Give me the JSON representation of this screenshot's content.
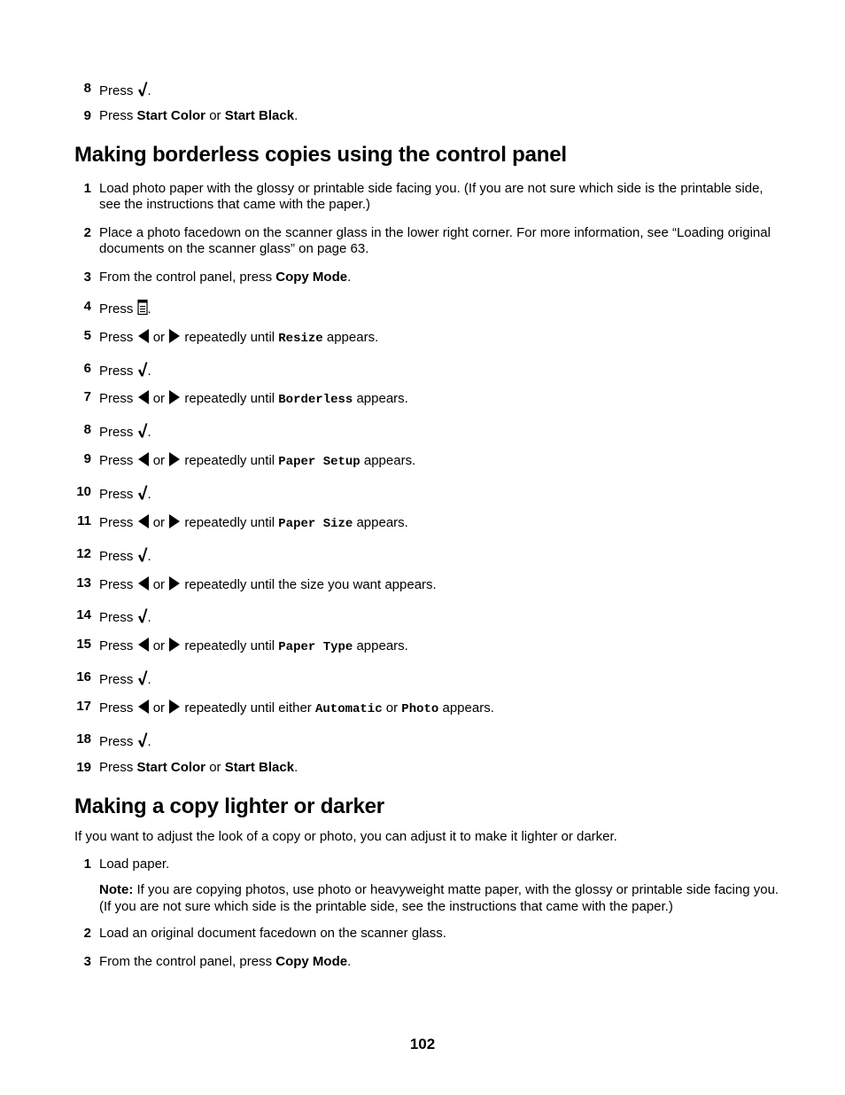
{
  "intro_steps": [
    {
      "num": "8",
      "press": "Press",
      "end": "."
    },
    {
      "num": "9",
      "press": "Press",
      "b1": "Start Color",
      "or": "or",
      "b2": "Start Black",
      "end": "."
    }
  ],
  "section1": {
    "title": "Making borderless copies using the control panel",
    "step1": {
      "num": "1",
      "text": "Load photo paper with the glossy or printable side facing you. (If you are not sure which side is the printable side, see the instructions that came with the paper.)"
    },
    "step2": {
      "num": "2",
      "text": "Place a photo facedown on the scanner glass in the lower right corner. For more information, see “Loading original documents on the scanner glass” on page 63."
    },
    "step3": {
      "num": "3",
      "pre": "From the control panel, press",
      "bold": "Copy Mode",
      "end": "."
    },
    "step4": {
      "num": "4",
      "press": "Press",
      "end": "."
    },
    "common": {
      "press": "Press",
      "or": "or",
      "until": "repeatedly until",
      "appears": "appears.",
      "dot": "."
    },
    "step5": {
      "num": "5",
      "value": "Resize"
    },
    "step6": {
      "num": "6"
    },
    "step7": {
      "num": "7",
      "value": "Borderless"
    },
    "step8": {
      "num": "8"
    },
    "step9": {
      "num": "9",
      "value": "Paper Setup"
    },
    "step10": {
      "num": "10"
    },
    "step11": {
      "num": "11",
      "value": "Paper Size"
    },
    "step12": {
      "num": "12"
    },
    "step13": {
      "num": "13",
      "tail": "repeatedly until the size you want appears."
    },
    "step14": {
      "num": "14"
    },
    "step15": {
      "num": "15",
      "value": "Paper Type"
    },
    "step16": {
      "num": "16"
    },
    "step17": {
      "num": "17",
      "until_either": "repeatedly until either",
      "v1": "Automatic",
      "or": "or",
      "v2": "Photo"
    },
    "step18": {
      "num": "18"
    },
    "step19": {
      "num": "19",
      "b1": "Start Color",
      "b2": "Start Black"
    }
  },
  "section2": {
    "title": "Making a copy lighter or darker",
    "intro": "If you want to adjust the look of a copy or photo, you can adjust it to make it lighter or darker.",
    "step1": {
      "num": "1",
      "text": "Load paper."
    },
    "note_label": "Note:",
    "note_text": " If you are copying photos, use photo or heavyweight matte paper, with the glossy or printable side facing you. (If you are not sure which side is the printable side, see the instructions that came with the paper.)",
    "step2": {
      "num": "2",
      "text": "Load an original document facedown on the scanner glass."
    },
    "step3": {
      "num": "3",
      "pre": "From the control panel, press",
      "bold": "Copy Mode",
      "end": "."
    }
  },
  "page_number": "102"
}
